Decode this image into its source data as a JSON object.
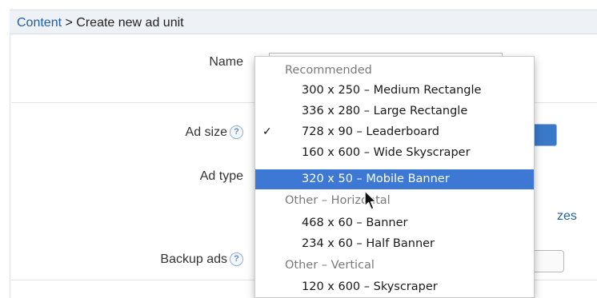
{
  "breadcrumb": {
    "link": "Content",
    "separator": " > ",
    "current": "Create new ad unit"
  },
  "form": {
    "name_label": "Name",
    "ad_size_label": "Ad size",
    "ad_type_label": "Ad type",
    "backup_ads_label": "Backup ads",
    "help_glyph": "?",
    "sizes_link_text": "zes"
  },
  "dropdown": {
    "checkmark": "✓",
    "items": [
      {
        "kind": "group",
        "label": "Recommended"
      },
      {
        "kind": "option",
        "label": "300 x 250 – Medium Rectangle"
      },
      {
        "kind": "option",
        "label": "336 x 280 – Large Rectangle"
      },
      {
        "kind": "option",
        "label": "728 x 90 – Leaderboard",
        "checked": true
      },
      {
        "kind": "option",
        "label": "160 x 600 – Wide Skyscraper"
      },
      {
        "kind": "option",
        "label": "320 x 50 – Mobile Banner",
        "highlighted": true
      },
      {
        "kind": "group",
        "label": "Other – Horizontal"
      },
      {
        "kind": "option",
        "label": "468 x 60 – Banner"
      },
      {
        "kind": "option",
        "label": "234 x 60 – Half Banner"
      },
      {
        "kind": "group",
        "label": "Other – Vertical"
      },
      {
        "kind": "option",
        "label": "120 x 600 – Skyscraper"
      }
    ]
  },
  "colors": {
    "accent": "#3d78d4",
    "link": "#1f5ea8"
  }
}
